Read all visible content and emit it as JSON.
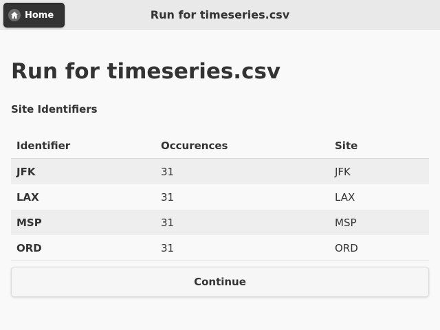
{
  "header": {
    "home_label": "Home",
    "home_icon": "home-icon",
    "title": "Run for timeseries.csv"
  },
  "main": {
    "page_title": "Run for timeseries.csv",
    "section_title": "Site Identifiers",
    "table": {
      "columns": [
        "Identifier",
        "Occurences",
        "Site"
      ],
      "rows": [
        [
          "JFK",
          "31",
          "JFK"
        ],
        [
          "LAX",
          "31",
          "LAX"
        ],
        [
          "MSP",
          "31",
          "MSP"
        ],
        [
          "ORD",
          "31",
          "ORD"
        ]
      ]
    },
    "continue_label": "Continue"
  },
  "colors": {
    "header_bg": "#e9e9e9",
    "button_dark": "#333333",
    "page_bg": "#f9f9f9",
    "row_stripe": "#eeeeee"
  }
}
